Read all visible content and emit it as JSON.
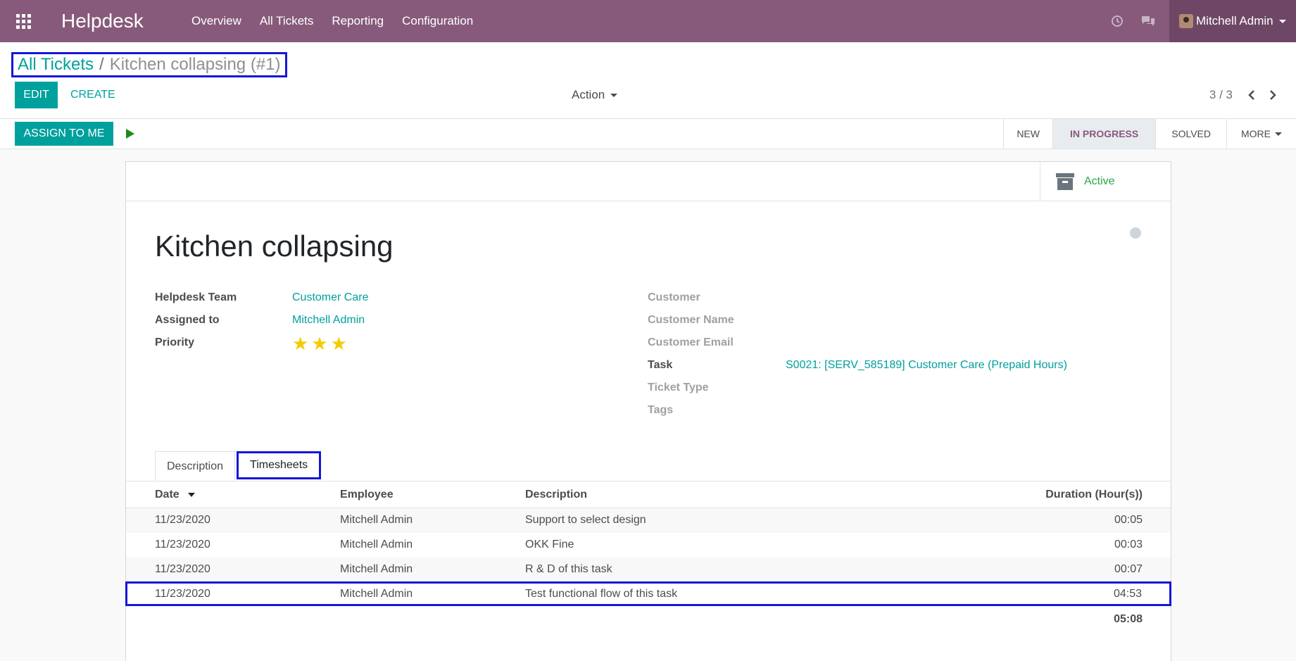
{
  "navbar": {
    "app_name": "Helpdesk",
    "menu": [
      "Overview",
      "All Tickets",
      "Reporting",
      "Configuration"
    ],
    "user_name": "Mitchell Admin",
    "icons": [
      "apps-grid-icon",
      "clock-icon",
      "chat-icon"
    ],
    "background": "#875a7b"
  },
  "breadcrumb": {
    "parent": "All Tickets",
    "separator": "/",
    "current": "Kitchen collapsing (#1)"
  },
  "buttons": {
    "edit": "EDIT",
    "create": "CREATE",
    "action": "Action",
    "assign_to_me": "ASSIGN TO ME"
  },
  "pager": {
    "value": "3 / 3"
  },
  "stages": {
    "items": [
      "NEW",
      "IN PROGRESS",
      "SOLVED",
      "MORE"
    ],
    "active": "IN PROGRESS"
  },
  "sheet": {
    "active_button": "Active",
    "title": "Kitchen collapsing",
    "left_fields": [
      {
        "label": "Helpdesk Team",
        "value": "Customer Care"
      },
      {
        "label": "Assigned to",
        "value": "Mitchell Admin"
      },
      {
        "label": "Priority",
        "value": ""
      }
    ],
    "priority_stars": 3,
    "right_fields": [
      {
        "label": "Customer",
        "value": ""
      },
      {
        "label": "Customer Name",
        "value": ""
      },
      {
        "label": "Customer Email",
        "value": ""
      },
      {
        "label": "Task",
        "value": "S0021: [SERV_585189] Customer Care (Prepaid Hours)"
      },
      {
        "label": "Ticket Type",
        "value": ""
      },
      {
        "label": "Tags",
        "value": ""
      }
    ]
  },
  "tabs": [
    "Description",
    "Timesheets"
  ],
  "timesheets": {
    "columns": [
      "Date",
      "Employee",
      "Description",
      "Duration (Hour(s))"
    ],
    "rows": [
      {
        "date": "11/23/2020",
        "employee": "Mitchell Admin",
        "description": "Support to select design",
        "duration": "00:05"
      },
      {
        "date": "11/23/2020",
        "employee": "Mitchell Admin",
        "description": "OKK Fine",
        "duration": "00:03"
      },
      {
        "date": "11/23/2020",
        "employee": "Mitchell Admin",
        "description": "R & D of this task",
        "duration": "00:07"
      },
      {
        "date": "11/23/2020",
        "employee": "Mitchell Admin",
        "description": "Test functional flow of this task",
        "duration": "04:53"
      }
    ],
    "total": "05:08"
  },
  "colors": {
    "primary": "#00a09d",
    "navbar": "#875a7b",
    "highlight_box": "#1616d8",
    "star": "#f3cc00",
    "active_green": "#28a745"
  }
}
